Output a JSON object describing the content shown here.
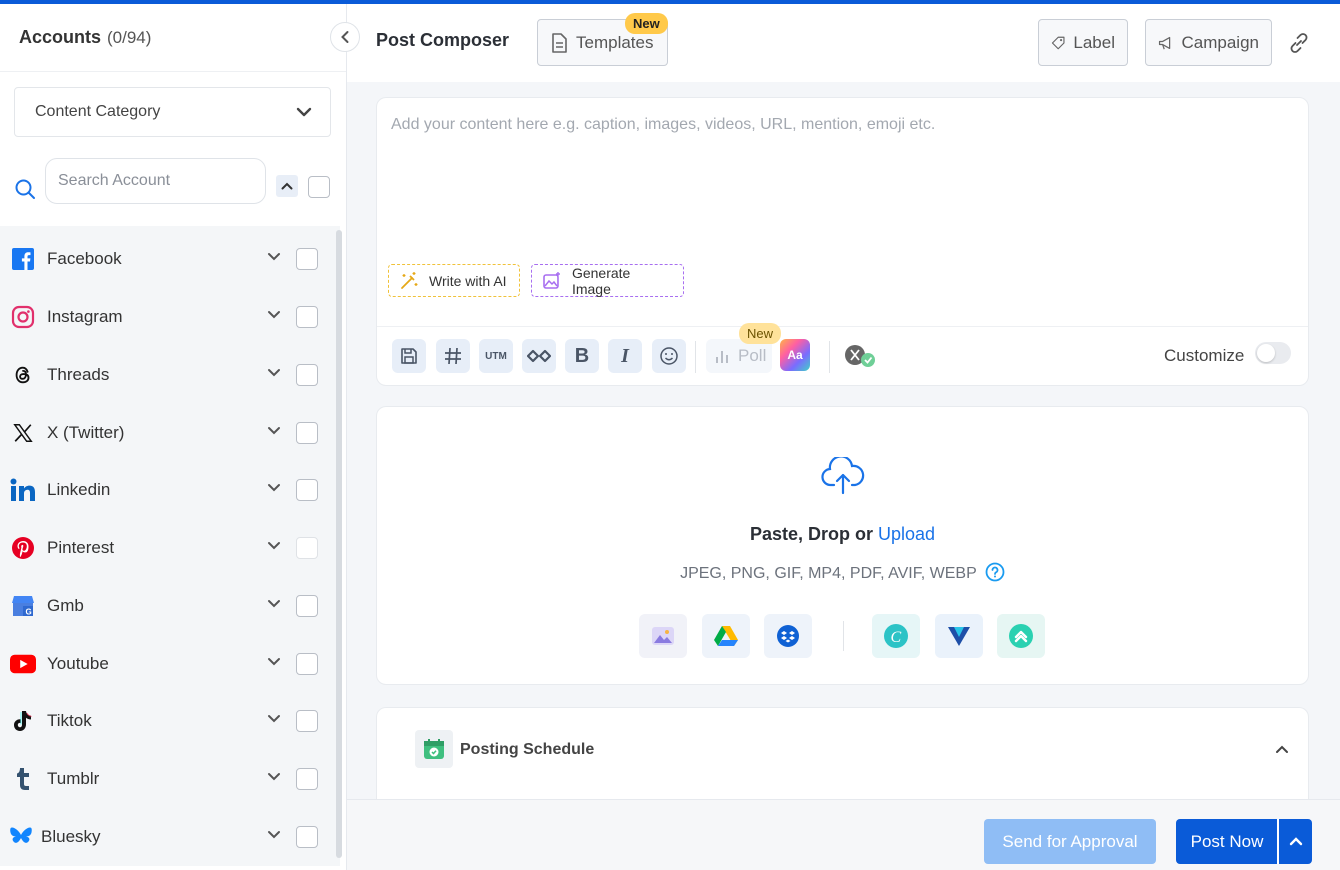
{
  "sidebar": {
    "title": "Accounts",
    "count": "(0/94)",
    "category_label": "Content Category",
    "search_placeholder": "Search Account",
    "accounts": [
      {
        "name": "Facebook",
        "icon": "facebook-icon"
      },
      {
        "name": "Instagram",
        "icon": "instagram-icon"
      },
      {
        "name": "Threads",
        "icon": "threads-icon"
      },
      {
        "name": "X (Twitter)",
        "icon": "x-twitter-icon"
      },
      {
        "name": "Linkedin",
        "icon": "linkedin-icon"
      },
      {
        "name": "Pinterest",
        "icon": "pinterest-icon"
      },
      {
        "name": "Gmb",
        "icon": "gmb-icon"
      },
      {
        "name": "Youtube",
        "icon": "youtube-icon"
      },
      {
        "name": "Tiktok",
        "icon": "tiktok-icon"
      },
      {
        "name": "Tumblr",
        "icon": "tumblr-icon"
      },
      {
        "name": "Bluesky",
        "icon": "bluesky-icon"
      }
    ]
  },
  "header": {
    "title": "Post Composer",
    "templates_label": "Templates",
    "new_badge": "New",
    "label_btn": "Label",
    "campaign_btn": "Campaign"
  },
  "composer": {
    "placeholder": "Add your content here e.g. caption, images, videos, URL, mention, emoji etc.",
    "write_ai": "Write with AI",
    "generate_image": "Generate Image",
    "utm_label": "UTM",
    "bold_label": "B",
    "italic_label": "I",
    "poll_label": "Poll",
    "poll_new_badge": "New",
    "aa_label": "Aa",
    "customize_label": "Customize"
  },
  "upload": {
    "title_prefix": "Paste, Drop or ",
    "title_link": "Upload",
    "file_types": "JPEG, PNG, GIF, MP4, PDF, AVIF, WEBP"
  },
  "schedule": {
    "title": "Posting Schedule"
  },
  "footer": {
    "approval_label": "Send for Approval",
    "post_now_label": "Post Now"
  },
  "colors": {
    "primary": "#0a5bd8",
    "approval_disabled": "#8fbdf5",
    "new_badge": "#ffc94a"
  }
}
